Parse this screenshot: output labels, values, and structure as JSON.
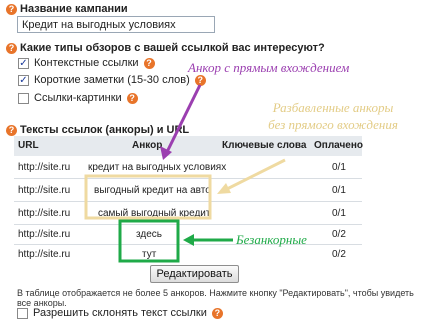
{
  "campaign": {
    "label": "Название кампании",
    "value": "Кредит на выгодных условиях"
  },
  "review_types": {
    "question": "Какие типы обзоров с вашей ссылкой вас интересуют?",
    "options": [
      {
        "label": "Контекстные ссылки",
        "checked": true
      },
      {
        "label": "Короткие заметки (15-30 слов)",
        "checked": true
      },
      {
        "label": "Ссылки-картинки",
        "checked": false
      }
    ]
  },
  "links": {
    "heading": "Тексты ссылок (анкоры) и URL",
    "columns": [
      "URL",
      "Анкор",
      "Ключевые слова",
      "Оплачено"
    ],
    "rows": [
      {
        "url": "http://site.ru",
        "anchor": "кредит на выгодных условиях",
        "keywords": "",
        "paid": "0/1"
      },
      {
        "url": "http://site.ru",
        "anchor": "выгодный кредит на авто",
        "keywords": "",
        "paid": "0/1"
      },
      {
        "url": "http://site.ru",
        "anchor": "самый выгодный кредит",
        "keywords": "",
        "paid": "0/1"
      },
      {
        "url": "http://site.ru",
        "anchor": "здесь",
        "keywords": "",
        "paid": "0/2"
      },
      {
        "url": "http://site.ru",
        "anchor": "тут",
        "keywords": "",
        "paid": "0/2"
      }
    ],
    "edit_button": "Редактировать",
    "note": "В таблице отображается не более 5 анкоров. Нажмите кнопку \"Редактировать\", чтобы увидеть все анкоры.",
    "allow_inflect": {
      "label": "Разрешить склонять текст ссылки",
      "checked": false
    }
  },
  "annotations": {
    "direct": "Анкор с прямым вхождением",
    "diluted_line1": "Разбавленные анкоры",
    "diluted_line2": "без прямого вхождения",
    "no_anchor": "Безанкорные"
  },
  "icons": {
    "help": "question-mark-icon",
    "check": "checkmark-icon"
  },
  "colors": {
    "help": "#e8742a",
    "header_bg": "#e6eaee",
    "purple": "#9b3fb0",
    "beige": "#e3cc86",
    "green": "#1faa48"
  }
}
